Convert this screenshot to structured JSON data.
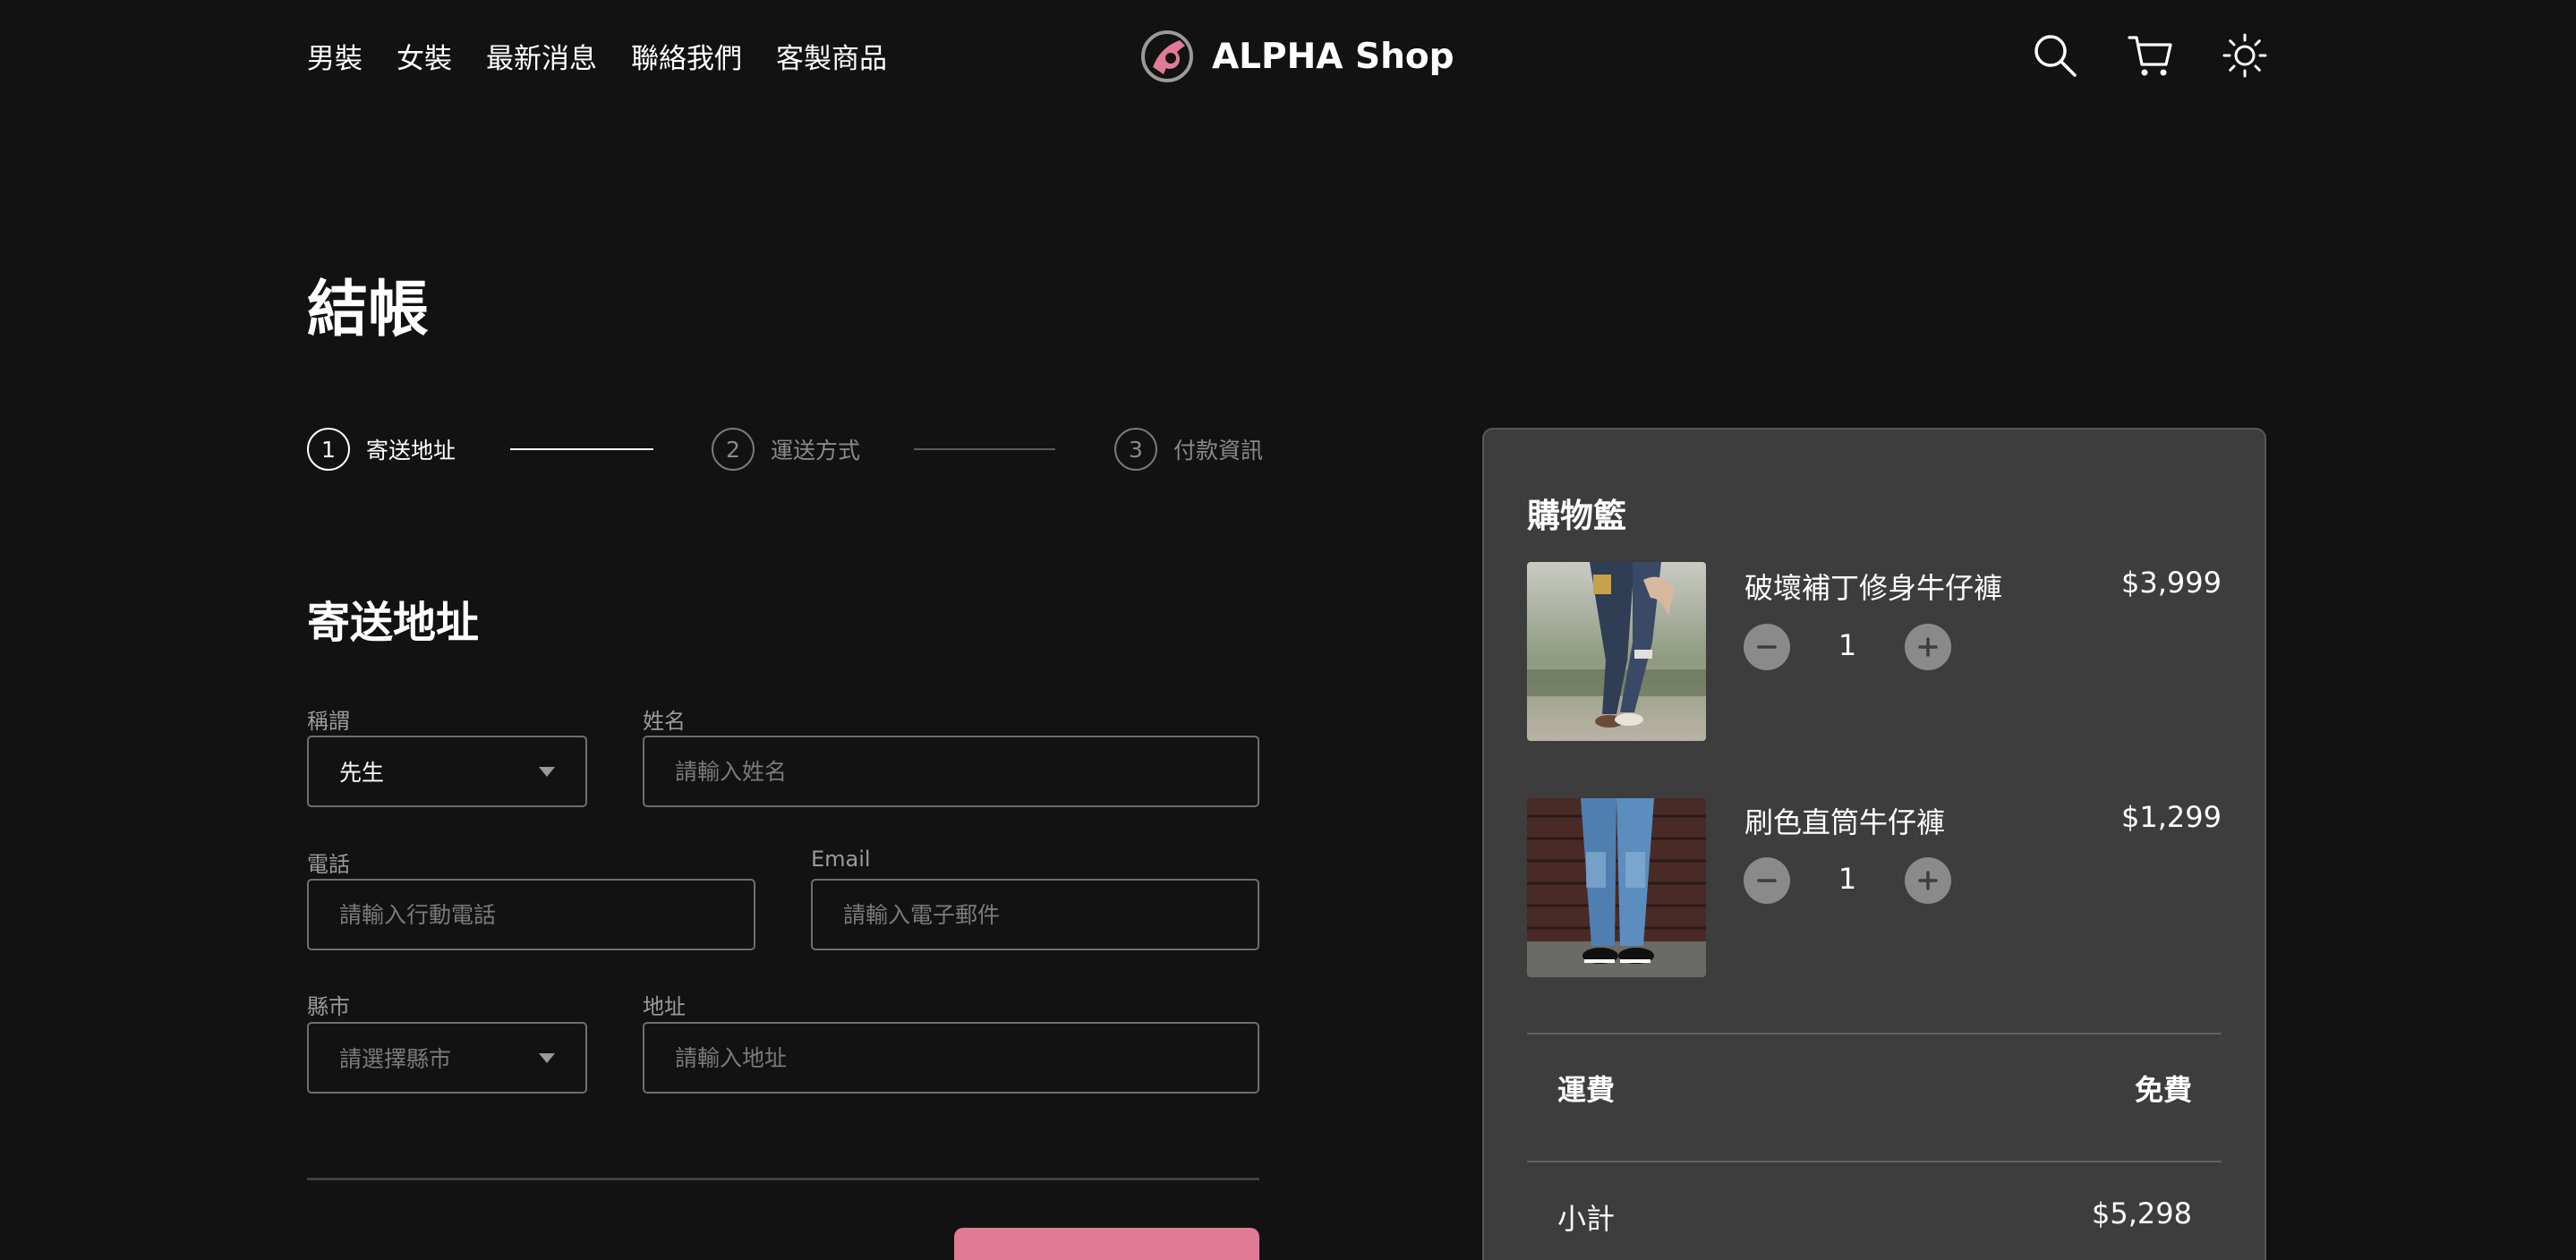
{
  "header": {
    "nav": [
      "男裝",
      "女裝",
      "最新消息",
      "聯絡我們",
      "客製商品"
    ],
    "brand": "ALPHA Shop",
    "icons": [
      "search-icon",
      "cart-icon",
      "sun-icon"
    ]
  },
  "page": {
    "title": "結帳"
  },
  "stepper": {
    "steps": [
      {
        "number": "1",
        "label": "寄送地址",
        "active": true
      },
      {
        "number": "2",
        "label": "運送方式",
        "active": false
      },
      {
        "number": "3",
        "label": "付款資訊",
        "active": false
      }
    ]
  },
  "form": {
    "section_title": "寄送地址",
    "salutation": {
      "label": "稱謂",
      "value": "先生"
    },
    "name": {
      "label": "姓名",
      "placeholder": "請輸入姓名"
    },
    "phone": {
      "label": "電話",
      "placeholder": "請輸入行動電話"
    },
    "email": {
      "label": "Email",
      "placeholder": "請輸入電子郵件"
    },
    "city": {
      "label": "縣市",
      "placeholder": "請選擇縣市"
    },
    "address": {
      "label": "地址",
      "placeholder": "請輸入地址"
    }
  },
  "cart": {
    "title": "購物籃",
    "items": [
      {
        "name": "破壞補丁修身牛仔褲",
        "price": "$3,999",
        "quantity": "1"
      },
      {
        "name": "刷色直筒牛仔褲",
        "price": "$1,299",
        "quantity": "1"
      }
    ],
    "shipping": {
      "label": "運費",
      "value": "免費"
    },
    "subtotal": {
      "label": "小計",
      "value": "$5,298"
    }
  },
  "colors": {
    "background": "#121212",
    "panel": "#3d3d3d",
    "accent": "#e07a96"
  }
}
